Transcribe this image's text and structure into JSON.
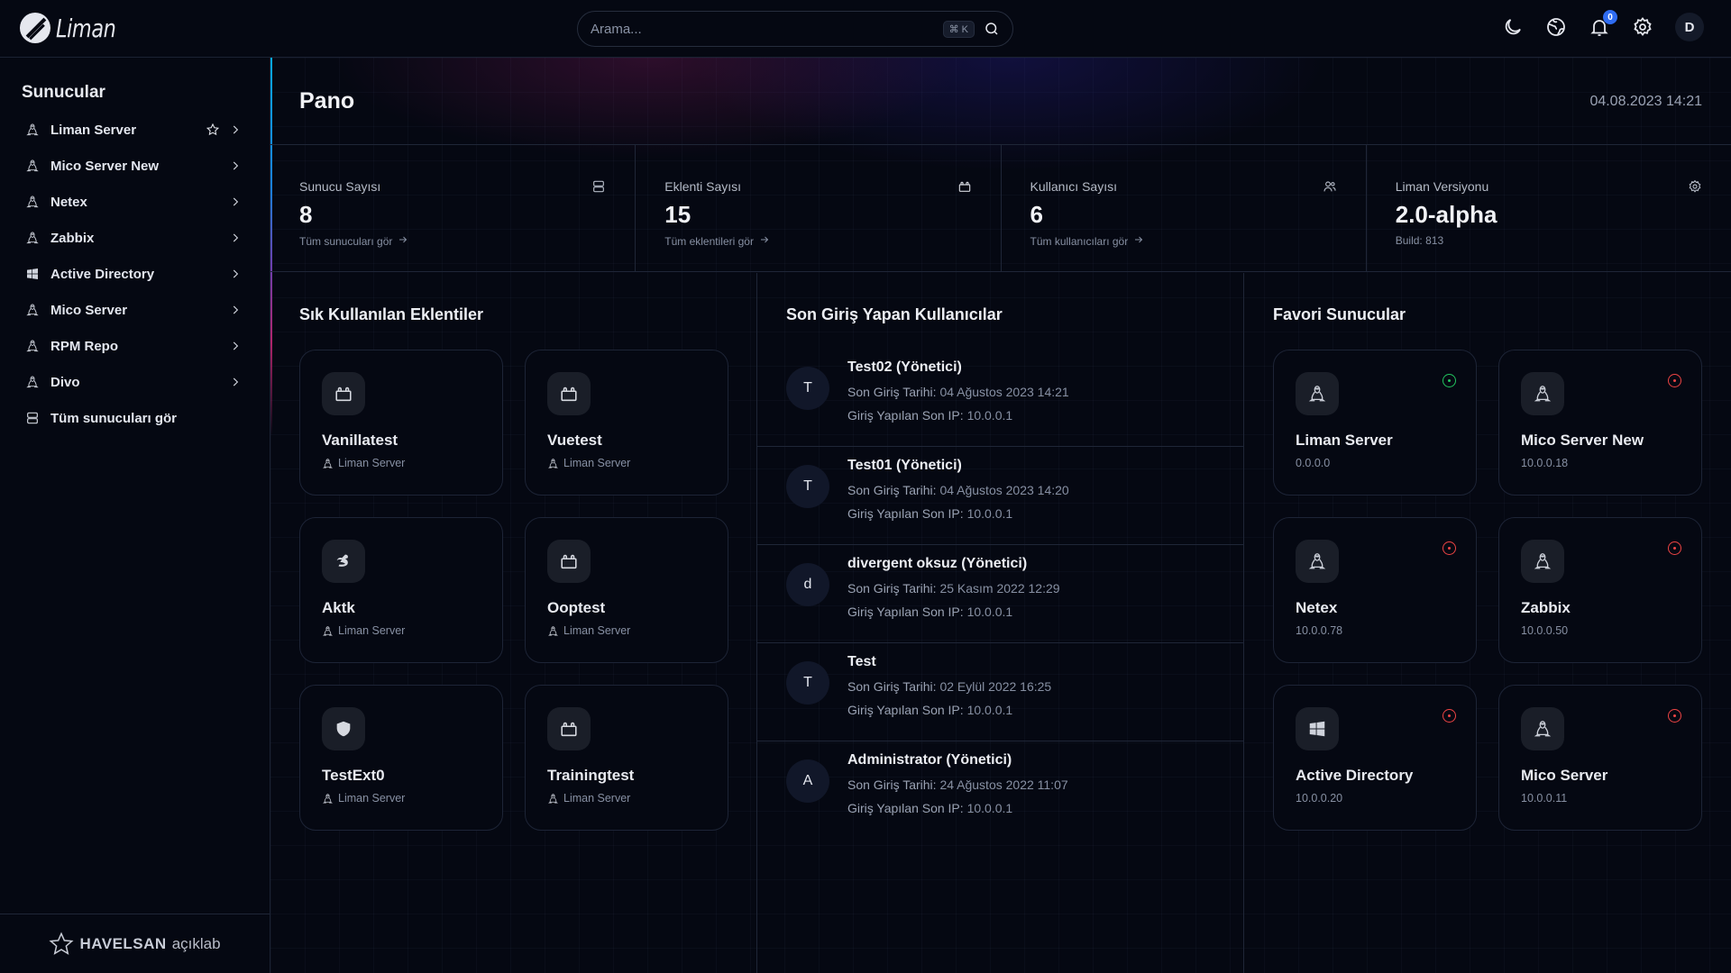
{
  "app": {
    "name": "Liman"
  },
  "header": {
    "search_placeholder": "Arama...",
    "search_shortcut": "⌘ K",
    "notification_count": "0",
    "user_initial": "D"
  },
  "sidebar": {
    "title": "Sunucular",
    "items": [
      {
        "label": "Liman Server",
        "icon": "linux-icon",
        "starred": true
      },
      {
        "label": "Mico Server New",
        "icon": "linux-icon"
      },
      {
        "label": "Netex",
        "icon": "linux-icon"
      },
      {
        "label": "Zabbix",
        "icon": "linux-icon"
      },
      {
        "label": "Active Directory",
        "icon": "windows-icon"
      },
      {
        "label": "Mico Server",
        "icon": "linux-icon"
      },
      {
        "label": "RPM Repo",
        "icon": "linux-icon"
      },
      {
        "label": "Divo",
        "icon": "linux-icon"
      }
    ],
    "all_servers": "Tüm sunucuları gör",
    "footer": {
      "brand": "HAVELSAN",
      "lab": "açıklab"
    }
  },
  "page": {
    "title": "Pano",
    "datetime": "04.08.2023 14:21"
  },
  "stats": [
    {
      "label": "Sunucu Sayısı",
      "value": "8",
      "link": "Tüm sunucuları gör",
      "icon": "server-icon"
    },
    {
      "label": "Eklenti Sayısı",
      "value": "15",
      "link": "Tüm eklentileri gör",
      "icon": "plugin-icon"
    },
    {
      "label": "Kullanıcı Sayısı",
      "value": "6",
      "link": "Tüm kullanıcıları gör",
      "icon": "users-icon"
    },
    {
      "label": "Liman Versiyonu",
      "value": "2.0-alpha",
      "link": "Build: 813",
      "icon": "gear-icon"
    }
  ],
  "extensions": {
    "title": "Sık Kullanılan Eklentiler",
    "items": [
      {
        "name": "Vanillatest",
        "server": "Liman Server",
        "icon": "plugin-icon"
      },
      {
        "name": "Vuetest",
        "server": "Liman Server",
        "icon": "plugin-icon"
      },
      {
        "name": "Aktk",
        "server": "Liman Server",
        "icon": "bird-icon"
      },
      {
        "name": "Ooptest",
        "server": "Liman Server",
        "icon": "plugin-icon"
      },
      {
        "name": "TestExt0",
        "server": "Liman Server",
        "icon": "shield-icon"
      },
      {
        "name": "Trainingtest",
        "server": "Liman Server",
        "icon": "plugin-icon"
      }
    ]
  },
  "users": {
    "title": "Son Giriş Yapan Kullanıcılar",
    "date_label": "Son Giriş Tarihi:",
    "ip_label": "Giriş Yapılan Son IP:",
    "items": [
      {
        "initial": "T",
        "name": "Test02 (Yönetici)",
        "date": "04 Ağustos 2023 14:21",
        "ip": "10.0.0.1"
      },
      {
        "initial": "T",
        "name": "Test01 (Yönetici)",
        "date": "04 Ağustos 2023 14:20",
        "ip": "10.0.0.1"
      },
      {
        "initial": "d",
        "name": "divergent oksuz (Yönetici)",
        "date": "25 Kasım 2022 12:29",
        "ip": "10.0.0.1"
      },
      {
        "initial": "T",
        "name": "Test",
        "date": "02 Eylül 2022 16:25",
        "ip": "10.0.0.1"
      },
      {
        "initial": "A",
        "name": "Administrator (Yönetici)",
        "date": "24 Ağustos 2022 11:07",
        "ip": "10.0.0.1"
      }
    ]
  },
  "favorites": {
    "title": "Favori Sunucular",
    "items": [
      {
        "name": "Liman Server",
        "ip": "0.0.0.0",
        "os": "linux",
        "status": "online"
      },
      {
        "name": "Mico Server New",
        "ip": "10.0.0.18",
        "os": "linux",
        "status": "offline"
      },
      {
        "name": "Netex",
        "ip": "10.0.0.78",
        "os": "linux",
        "status": "offline"
      },
      {
        "name": "Zabbix",
        "ip": "10.0.0.50",
        "os": "linux",
        "status": "offline"
      },
      {
        "name": "Active Directory",
        "ip": "10.0.0.20",
        "os": "windows",
        "status": "offline"
      },
      {
        "name": "Mico Server",
        "ip": "10.0.0.11",
        "os": "linux",
        "status": "offline"
      }
    ]
  },
  "colors": {
    "online": "#22c55e",
    "offline": "#ef4444",
    "accent": "#2f6cf2"
  }
}
